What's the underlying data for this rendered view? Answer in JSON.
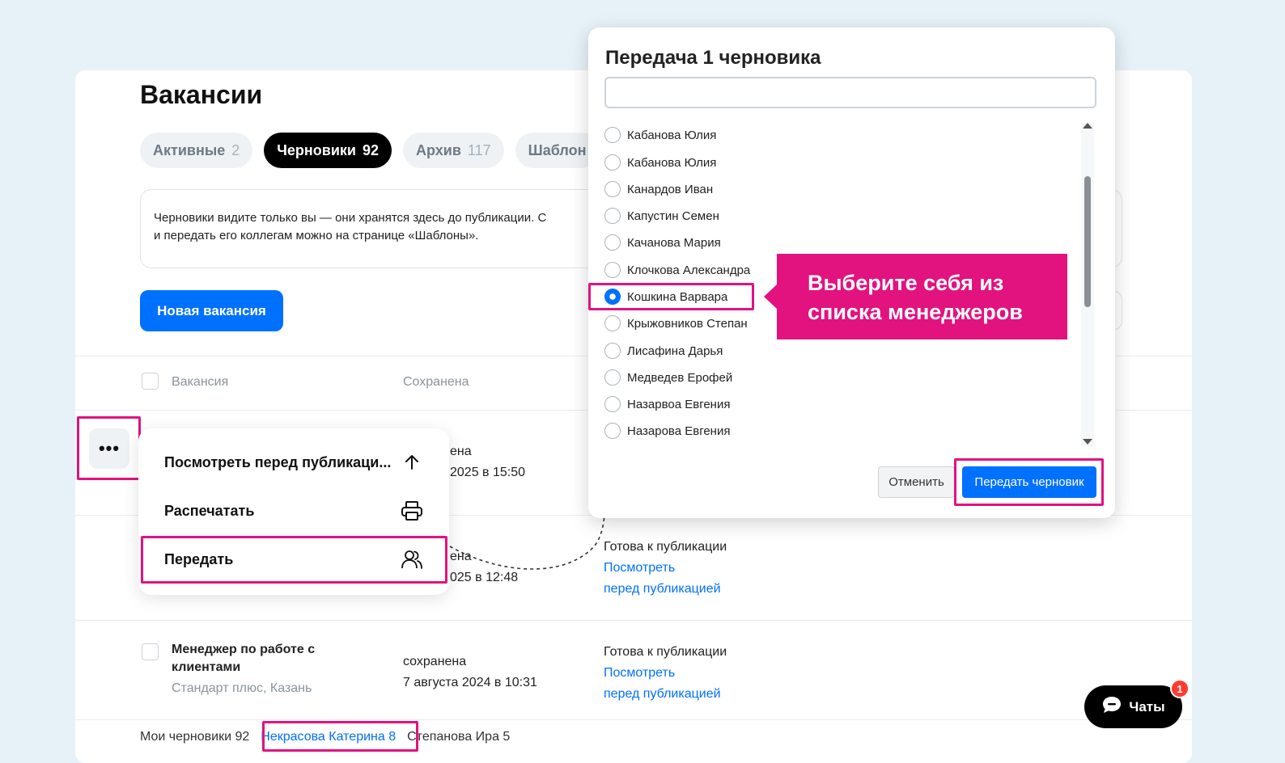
{
  "page": {
    "title": "Вакансии",
    "tabs": [
      {
        "label": "Активные",
        "count": "2"
      },
      {
        "label": "Черновики",
        "count": "92"
      },
      {
        "label": "Архив",
        "count": "117"
      },
      {
        "label": "Шаблон",
        "count": ""
      }
    ],
    "info_line1": "Черновики видите только вы — они хранятся здесь до публикации. С",
    "info_line2": "и передать его коллегам можно на странице «Шаблоны».",
    "new_button": "Новая вакансия"
  },
  "table": {
    "col_vacancy": "Вакансия",
    "col_saved": "Сохранена",
    "rows": [
      {
        "saved_line1": "ена",
        "saved_line2": "2025 в 15:50"
      },
      {
        "saved_line1": "ена",
        "saved_line2": "025 в 12:48",
        "status": "Готова к публикации",
        "link1": "Посмотреть",
        "link2": "перед публикацией"
      },
      {
        "title_line1": "Менеджер по работе с",
        "title_line2": "клиентами",
        "subtitle": "Стандарт плюс, Казань",
        "saved_line1": "сохранена",
        "saved_line2": "7 августа 2024 в 10:31",
        "status": "Готова к публикации",
        "link1": "Посмотреть",
        "link2": "перед публикацией"
      }
    ]
  },
  "footer_tabs": {
    "mine": "Мои черновики 92",
    "colleague1": "Некрасова Катерина 8",
    "colleague2": "Степанова Ира 5"
  },
  "more_button": "•••",
  "context_menu": {
    "preview": "Посмотреть перед публикаци...",
    "print": "Распечатать",
    "transfer": "Передать"
  },
  "modal": {
    "title": "Передача 1 черновика",
    "search_value": "",
    "options": [
      "Кабанова Юлия",
      "Кабанова Юлия",
      "Канардов Иван",
      "Капустин Семен",
      "Качанова Мария",
      "Клочкова Александра",
      "Кошкина Варвара",
      "Крыжовников Степан",
      "Лисафина Дарья",
      "Медведев Ерофей",
      "Назарвоа Евгения",
      "Назарова Евгения"
    ],
    "selected_index": 6,
    "cancel_button": "Отменить",
    "submit_button": "Передать черновик"
  },
  "callout": {
    "line1": "Выберите себя из",
    "line2": "списка менеджеров"
  },
  "chat": {
    "label": "Чаты",
    "badge": "1"
  },
  "colors": {
    "accent": "#0070ff",
    "highlight": "#e2127f",
    "badge": "#ff3b30"
  },
  "icons": [
    "arrow-up-icon",
    "printer-icon",
    "users-icon",
    "chat-bubble-icon"
  ]
}
